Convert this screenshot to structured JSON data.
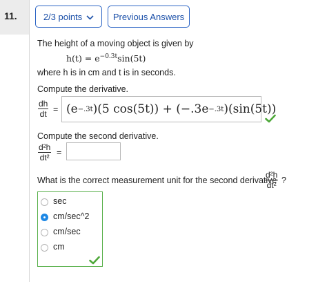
{
  "question": {
    "number": "11.",
    "points_label": "2/3 points",
    "previous_answers_label": "Previous Answers"
  },
  "problem": {
    "intro": "The height of a moving object is given by",
    "function_lhs": "h(t) = e",
    "function_exponent": "−0.3t",
    "function_rhs": "sin(5t)",
    "where_text": "where h is in cm and t is in seconds.",
    "part1_prompt": "Compute the derivative.",
    "dh_num": "dh",
    "dh_den": "dt",
    "equals": "=",
    "part1_answer_a": "(e",
    "part1_answer_a_exp": "−.3t",
    "part1_answer_b": ")(5 cos(5t)) + (−.3e",
    "part1_answer_b_exp": "−.3t",
    "part1_answer_c": ")(sin(5t))",
    "part2_prompt": "Compute the second derivative.",
    "d2h_num": "d²h",
    "d2h_den": "dt²",
    "part3_prompt": "What is the correct measurement unit for the second derivative",
    "qmark": "?"
  },
  "choices": [
    {
      "label": "sec",
      "selected": false
    },
    {
      "label": "cm/sec^2",
      "selected": true
    },
    {
      "label": "cm/sec",
      "selected": false
    },
    {
      "label": "cm",
      "selected": false
    }
  ],
  "colors": {
    "accent": "#2a63c4",
    "correct": "#4ea83a",
    "selected_radio": "#1e88e5"
  },
  "icons": {
    "check": "checkmark-icon",
    "dropdown": "chevron-down-icon"
  }
}
